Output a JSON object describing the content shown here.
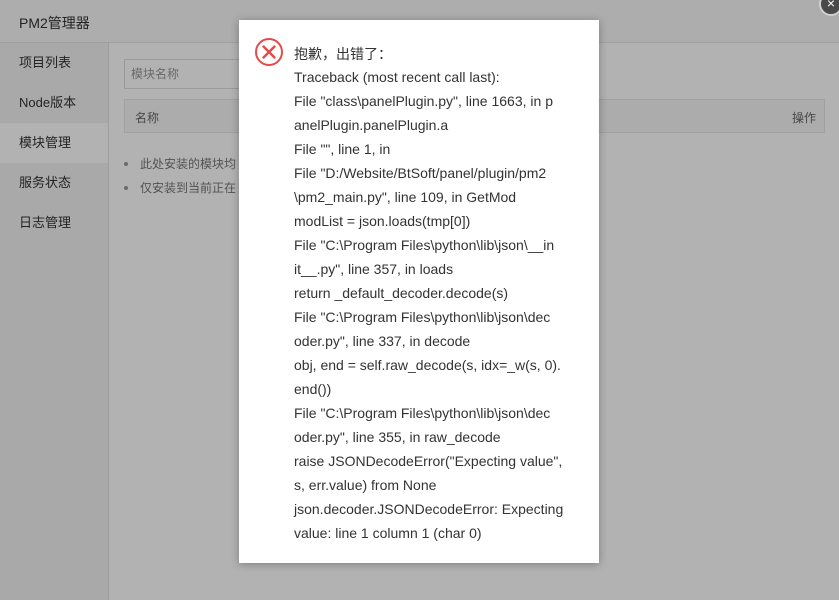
{
  "window": {
    "title": "PM2管理器",
    "close_glyph": "×"
  },
  "sidebar": {
    "items": [
      {
        "label": "项目列表"
      },
      {
        "label": "Node版本"
      },
      {
        "label": "模块管理"
      },
      {
        "label": "服务状态"
      },
      {
        "label": "日志管理"
      }
    ]
  },
  "main": {
    "search_placeholder": "模块名称",
    "table": {
      "col_name": "名称",
      "col_op": "操作"
    },
    "notes": [
      "此处安装的模块均",
      "仅安装到当前正在"
    ]
  },
  "dialog": {
    "icon": "error-circle-x-icon",
    "title": "抱歉，出错了：",
    "lines": [
      "Traceback (most recent call last):",
      "File \"class\\panelPlugin.py\", line 1663, in p",
      "anelPlugin.panelPlugin.a",
      "File \"\", line 1, in",
      "File \"D:/Website/BtSoft/panel/plugin/pm2",
      "\\pm2_main.py\", line 109, in GetMod",
      "modList = json.loads(tmp[0])",
      "File \"C:\\Program Files\\python\\lib\\json\\__in",
      "it__.py\", line 357, in loads",
      "return _default_decoder.decode(s)",
      "File \"C:\\Program Files\\python\\lib\\json\\dec",
      "oder.py\", line 337, in decode",
      "obj, end = self.raw_decode(s, idx=_w(s, 0).",
      "end())",
      "File \"C:\\Program Files\\python\\lib\\json\\dec",
      "oder.py\", line 355, in raw_decode",
      "raise JSONDecodeError(\"Expecting value\",",
      "s, err.value) from None",
      "json.decoder.JSONDecodeError: Expecting",
      "value: line 1 column 1 (char 0)"
    ]
  },
  "colors": {
    "error_red": "#e64a4a",
    "active_bg": "#ffffff",
    "sidebar_bg": "#f2f2f2"
  }
}
